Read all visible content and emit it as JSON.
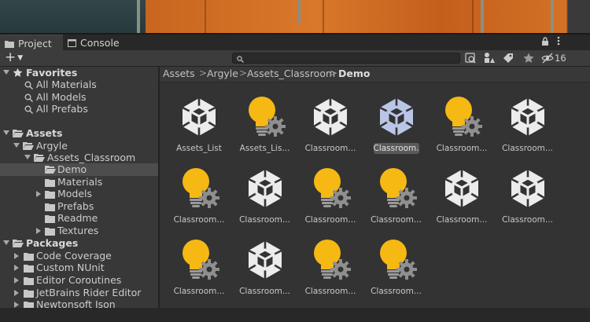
{
  "tabs": {
    "project": "Project",
    "console": "Console"
  },
  "toolbar": {
    "search_placeholder": "",
    "hidden_count": "16"
  },
  "sidebar": {
    "favorites_label": "Favorites",
    "favorites": [
      "All Materials",
      "All Models",
      "All Prefabs"
    ],
    "assets_label": "Assets",
    "argyle": "Argyle",
    "assets_classroom": "Assets_Classroom",
    "demo": "Demo",
    "materials": "Materials",
    "models": "Models",
    "prefabs": "Prefabs",
    "readme": "Readme",
    "textures": "Textures",
    "packages_label": "Packages",
    "packages": [
      "Code Coverage",
      "Custom NUnit",
      "Editor Coroutines",
      "JetBrains Rider Editor",
      "Newtonsoft Json"
    ]
  },
  "breadcrumb": [
    "Assets",
    "Argyle",
    "Assets_Classroom",
    "Demo"
  ],
  "items": [
    {
      "name": "Assets_List",
      "type": "unity"
    },
    {
      "name": "Assets_Lis...",
      "type": "bulb"
    },
    {
      "name": "Classroom...",
      "type": "unity"
    },
    {
      "name": "Classroom...",
      "type": "unity-sel"
    },
    {
      "name": "Classroom...",
      "type": "bulb"
    },
    {
      "name": "Classroom...",
      "type": "unity"
    },
    {
      "name": "Classroom...",
      "type": "bulb"
    },
    {
      "name": "Classroom...",
      "type": "unity"
    },
    {
      "name": "Classroom...",
      "type": "bulb"
    },
    {
      "name": "Classroom...",
      "type": "bulb"
    },
    {
      "name": "Classroom...",
      "type": "unity"
    },
    {
      "name": "Classroom...",
      "type": "unity"
    },
    {
      "name": "Classroom...",
      "type": "bulb"
    },
    {
      "name": "Classroom...",
      "type": "unity"
    },
    {
      "name": "Classroom...",
      "type": "bulb"
    },
    {
      "name": "Classroom...",
      "type": "bulb"
    }
  ],
  "colors": {
    "bulb": "#f6b813",
    "unity": "#ececec",
    "unity_selected": "#b9c6e6",
    "selection": "#4d4d4d"
  }
}
